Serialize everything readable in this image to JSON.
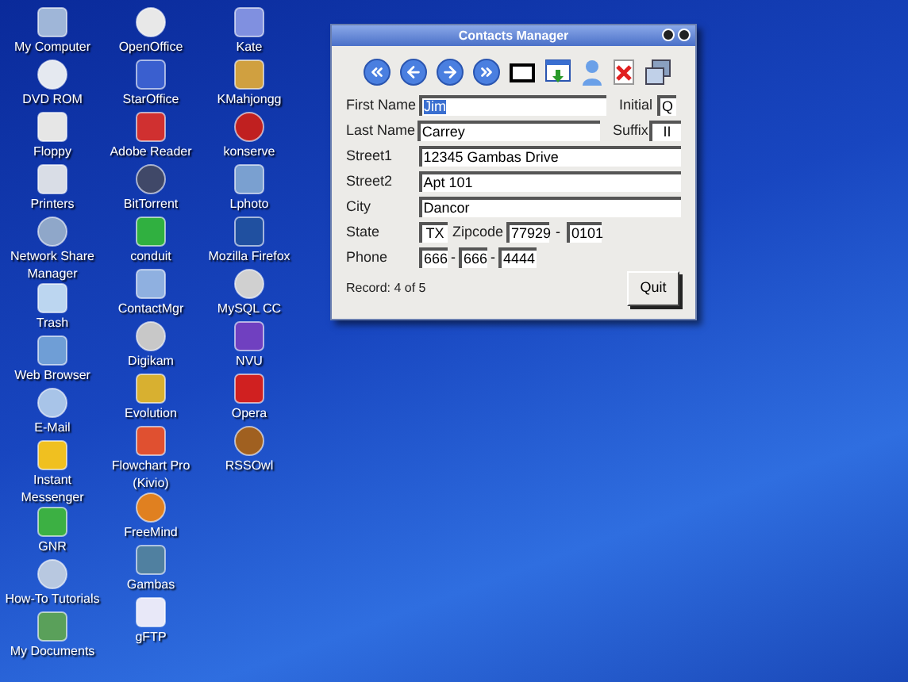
{
  "desktop_icons": [
    {
      "column": [
        {
          "label": "My Computer"
        },
        {
          "label": "DVD ROM"
        },
        {
          "label": "Floppy"
        },
        {
          "label": "Printers"
        },
        {
          "label": "Network Share Manager"
        },
        {
          "label": "Trash"
        },
        {
          "label": "Web Browser"
        },
        {
          "label": "E-Mail"
        },
        {
          "label": "Instant Messenger"
        },
        {
          "label": "GNR"
        },
        {
          "label": "How-To Tutorials"
        },
        {
          "label": "My Documents"
        }
      ]
    },
    {
      "column": [
        {
          "label": "OpenOffice"
        },
        {
          "label": "StarOffice"
        },
        {
          "label": "Adobe Reader"
        },
        {
          "label": "BitTorrent"
        },
        {
          "label": "conduit"
        },
        {
          "label": "ContactMgr"
        },
        {
          "label": "Digikam"
        },
        {
          "label": "Evolution"
        },
        {
          "label": "Flowchart Pro (Kivio)"
        },
        {
          "label": "FreeMind"
        },
        {
          "label": "Gambas"
        },
        {
          "label": "gFTP"
        }
      ]
    },
    {
      "column": [
        {
          "label": "Kate"
        },
        {
          "label": "KMahjongg"
        },
        {
          "label": "konserve"
        },
        {
          "label": "Lphoto"
        },
        {
          "label": "Mozilla Firefox"
        },
        {
          "label": "MySQL CC"
        },
        {
          "label": "NVU"
        },
        {
          "label": "Opera"
        },
        {
          "label": "RSSOwl"
        }
      ]
    }
  ],
  "window": {
    "title": "Contacts Manager",
    "first_name": {
      "label": "First Name",
      "value": "Jim",
      "selected": true
    },
    "initial": {
      "label": "Initial",
      "value": "Q"
    },
    "last_name": {
      "label": "Last Name",
      "value": "Carrey"
    },
    "suffix": {
      "label": "Suffix",
      "value": "II"
    },
    "street1": {
      "label": "Street1",
      "value": "12345 Gambas Drive"
    },
    "street2": {
      "label": "Street2",
      "value": "Apt 101"
    },
    "city": {
      "label": "City",
      "value": "Dancor"
    },
    "state": {
      "label": "State",
      "value": "TX"
    },
    "zipcode": {
      "label": "Zipcode",
      "value": "77929",
      "separator": "-",
      "extension": "0101"
    },
    "phone": {
      "label": "Phone",
      "parts": [
        "666",
        "666",
        "4444"
      ],
      "separator": "-"
    },
    "record": "Record: 4 of 5",
    "quit": "Quit"
  }
}
